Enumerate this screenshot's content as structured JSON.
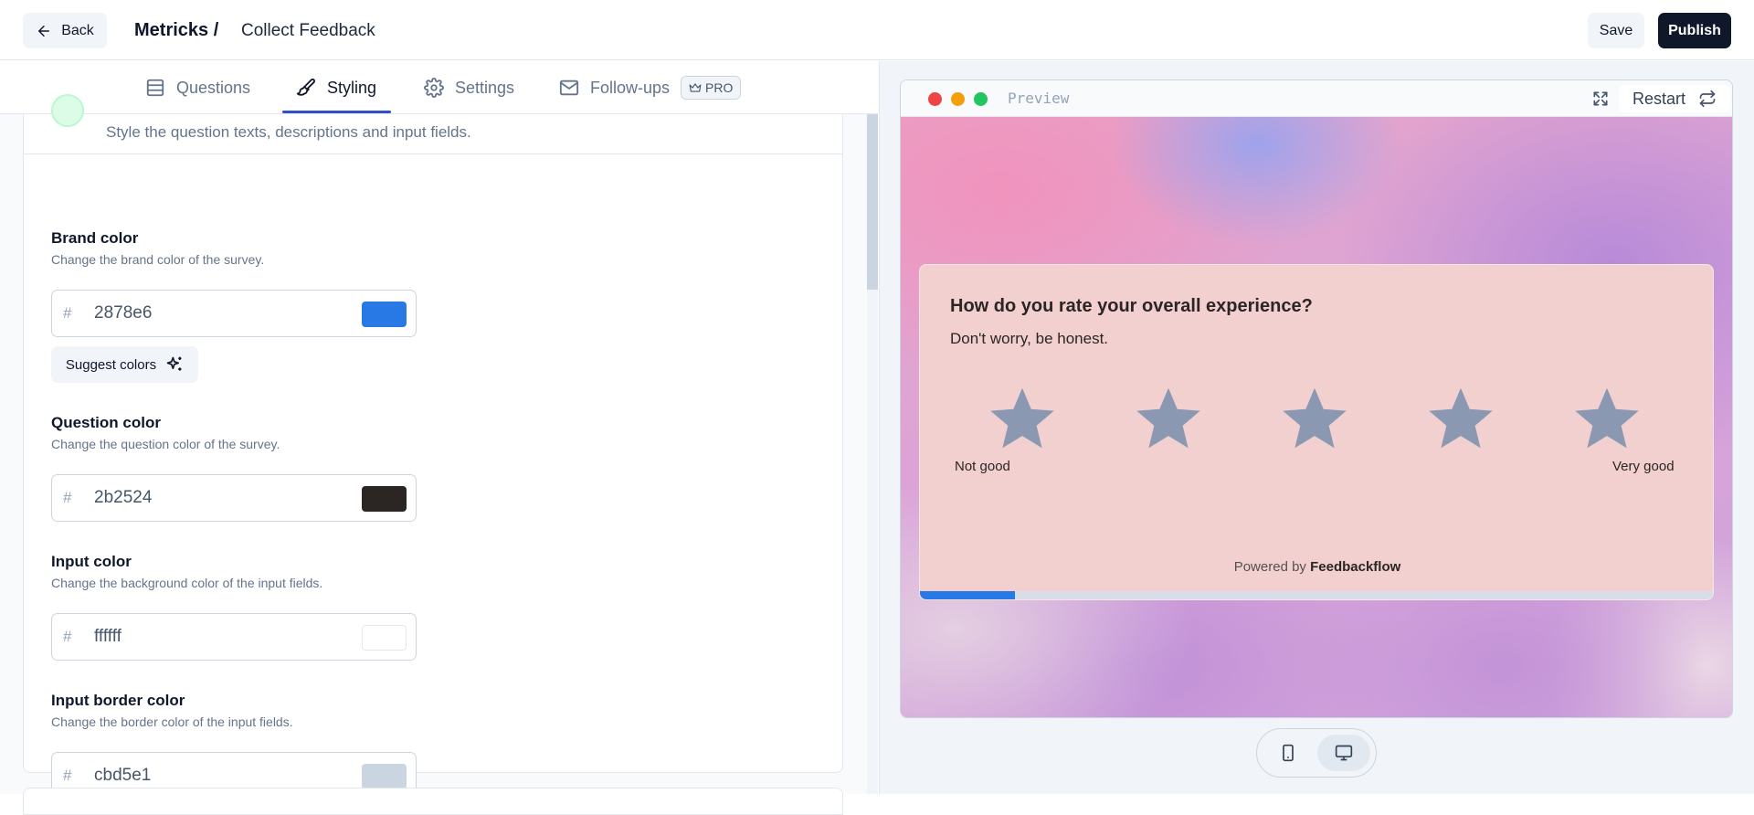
{
  "header": {
    "back_label": "Back",
    "breadcrumb_root": "Metricks /",
    "breadcrumb_leaf": "Collect Feedback",
    "save_label": "Save",
    "publish_label": "Publish"
  },
  "tabs": [
    {
      "label": "Questions",
      "icon": "list-icon",
      "active": false
    },
    {
      "label": "Styling",
      "icon": "paintbrush-icon",
      "active": true
    },
    {
      "label": "Settings",
      "icon": "gear-icon",
      "active": false
    },
    {
      "label": "Follow-ups",
      "icon": "mail-icon",
      "active": false,
      "badge": "PRO"
    }
  ],
  "styling": {
    "section_description": "Style the question texts, descriptions and input fields.",
    "fields": [
      {
        "label": "Brand color",
        "description": "Change the brand color of the survey.",
        "value": "2878e6",
        "swatch": "#2878e6"
      },
      {
        "label": "Question color",
        "description": "Change the question color of the survey.",
        "value": "2b2524",
        "swatch": "#2b2524"
      },
      {
        "label": "Input color",
        "description": "Change the background color of the input fields.",
        "value": "ffffff",
        "swatch": "#ffffff"
      },
      {
        "label": "Input border color",
        "description": "Change the border color of the input fields.",
        "value": "cbd5e1",
        "swatch": "#cbd5e1"
      }
    ],
    "hash": "#",
    "suggest_label": "Suggest colors"
  },
  "preview": {
    "title": "Preview",
    "restart_label": "Restart",
    "question": "How do you rate your overall experience?",
    "subheader": "Don't worry, be honest.",
    "stars": 5,
    "low_label": "Not good",
    "high_label": "Very good",
    "powered_prefix": "Powered by",
    "powered_brand": "Feedbackflow",
    "progress": 0.12,
    "window_dots": [
      "#ef4444",
      "#f59e0b",
      "#22c55e"
    ],
    "star_color": "#8a99b1",
    "card_bg": "#f2d0d0"
  },
  "device_toggle": {
    "active": "desktop"
  }
}
